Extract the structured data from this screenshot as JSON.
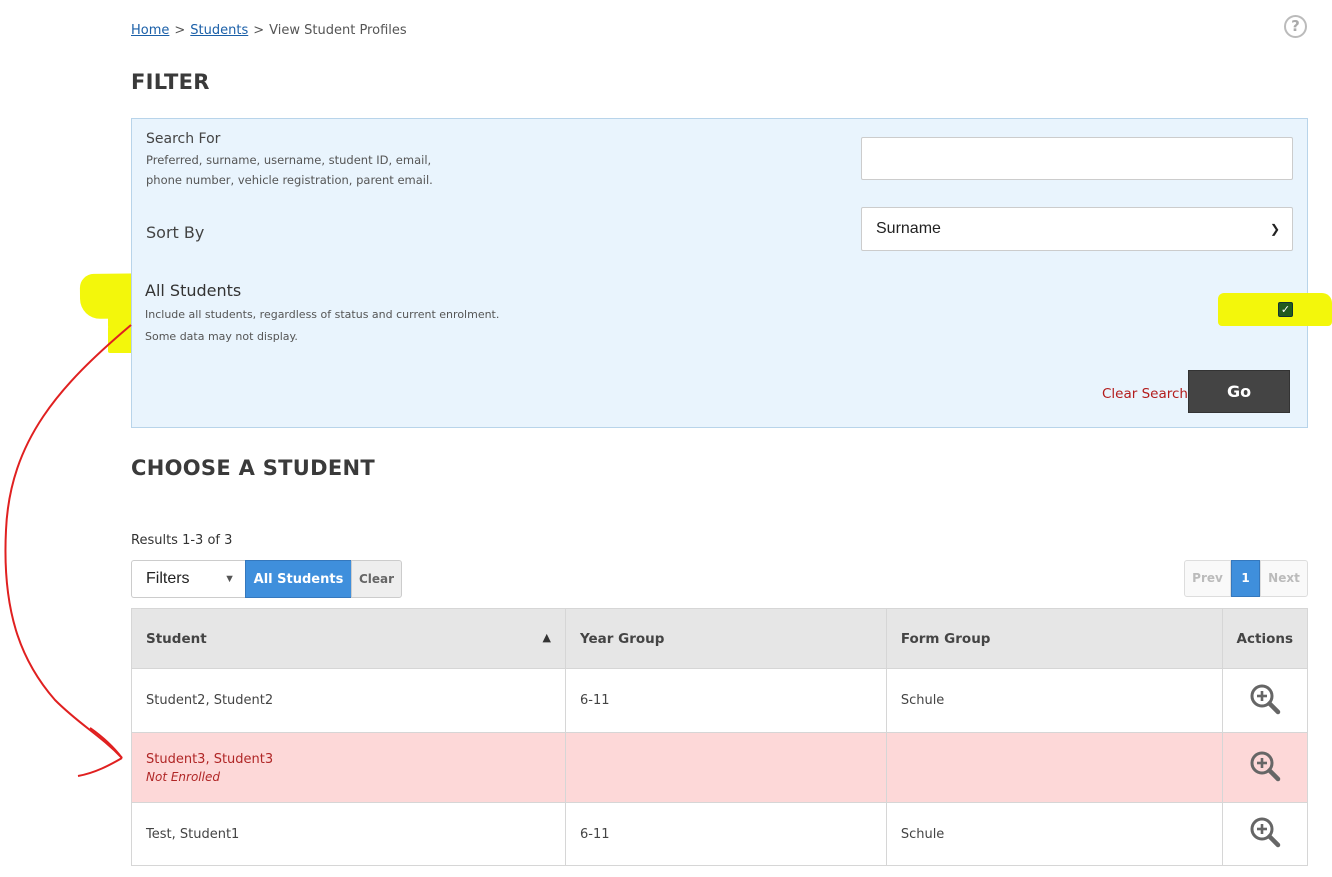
{
  "breadcrumb": {
    "home": "Home",
    "students": "Students",
    "current": "View Student Profiles",
    "sep": ">"
  },
  "help_glyph": "?",
  "filter": {
    "heading": "FILTER",
    "search_label": "Search For",
    "search_hint_1": "Preferred, surname, username, student ID, email,",
    "search_hint_2": "phone number, vehicle registration, parent email.",
    "search_value": "",
    "sort_label": "Sort By",
    "sort_value": "Surname",
    "all_label": "All Students",
    "all_hint_1": "Include all students, regardless of status and current enrolment.",
    "all_hint_2": "Some data may not display.",
    "all_checked": true,
    "clear_link": "Clear Search",
    "go": "Go"
  },
  "choose": {
    "heading": "CHOOSE A STUDENT",
    "results": "Results 1-3 of 3",
    "filters_dd": "Filters",
    "all_btn": "All Students",
    "clear_btn": "Clear",
    "pager": {
      "prev": "Prev",
      "page": "1",
      "next": "Next"
    }
  },
  "table": {
    "headers": {
      "student": "Student",
      "year": "Year Group",
      "form": "Form Group",
      "actions": "Actions"
    },
    "rows": [
      {
        "student": "Student2, Student2",
        "status": "",
        "year": "6-11",
        "form": "Schule"
      },
      {
        "student": "Student3, Student3",
        "status": "Not Enrolled",
        "year": "",
        "form": ""
      },
      {
        "student": "Test, Student1",
        "status": "",
        "year": "6-11",
        "form": "Schule"
      }
    ]
  },
  "icons": {
    "view": "magnifier-plus-icon",
    "sort": "sort-ascending-icon",
    "help": "help-circle-icon"
  },
  "colors": {
    "highlight": "#f3f70b",
    "annotation": "#e02020",
    "not_enrolled_row": "#fdd8d8",
    "primary": "#3f8fdc"
  }
}
